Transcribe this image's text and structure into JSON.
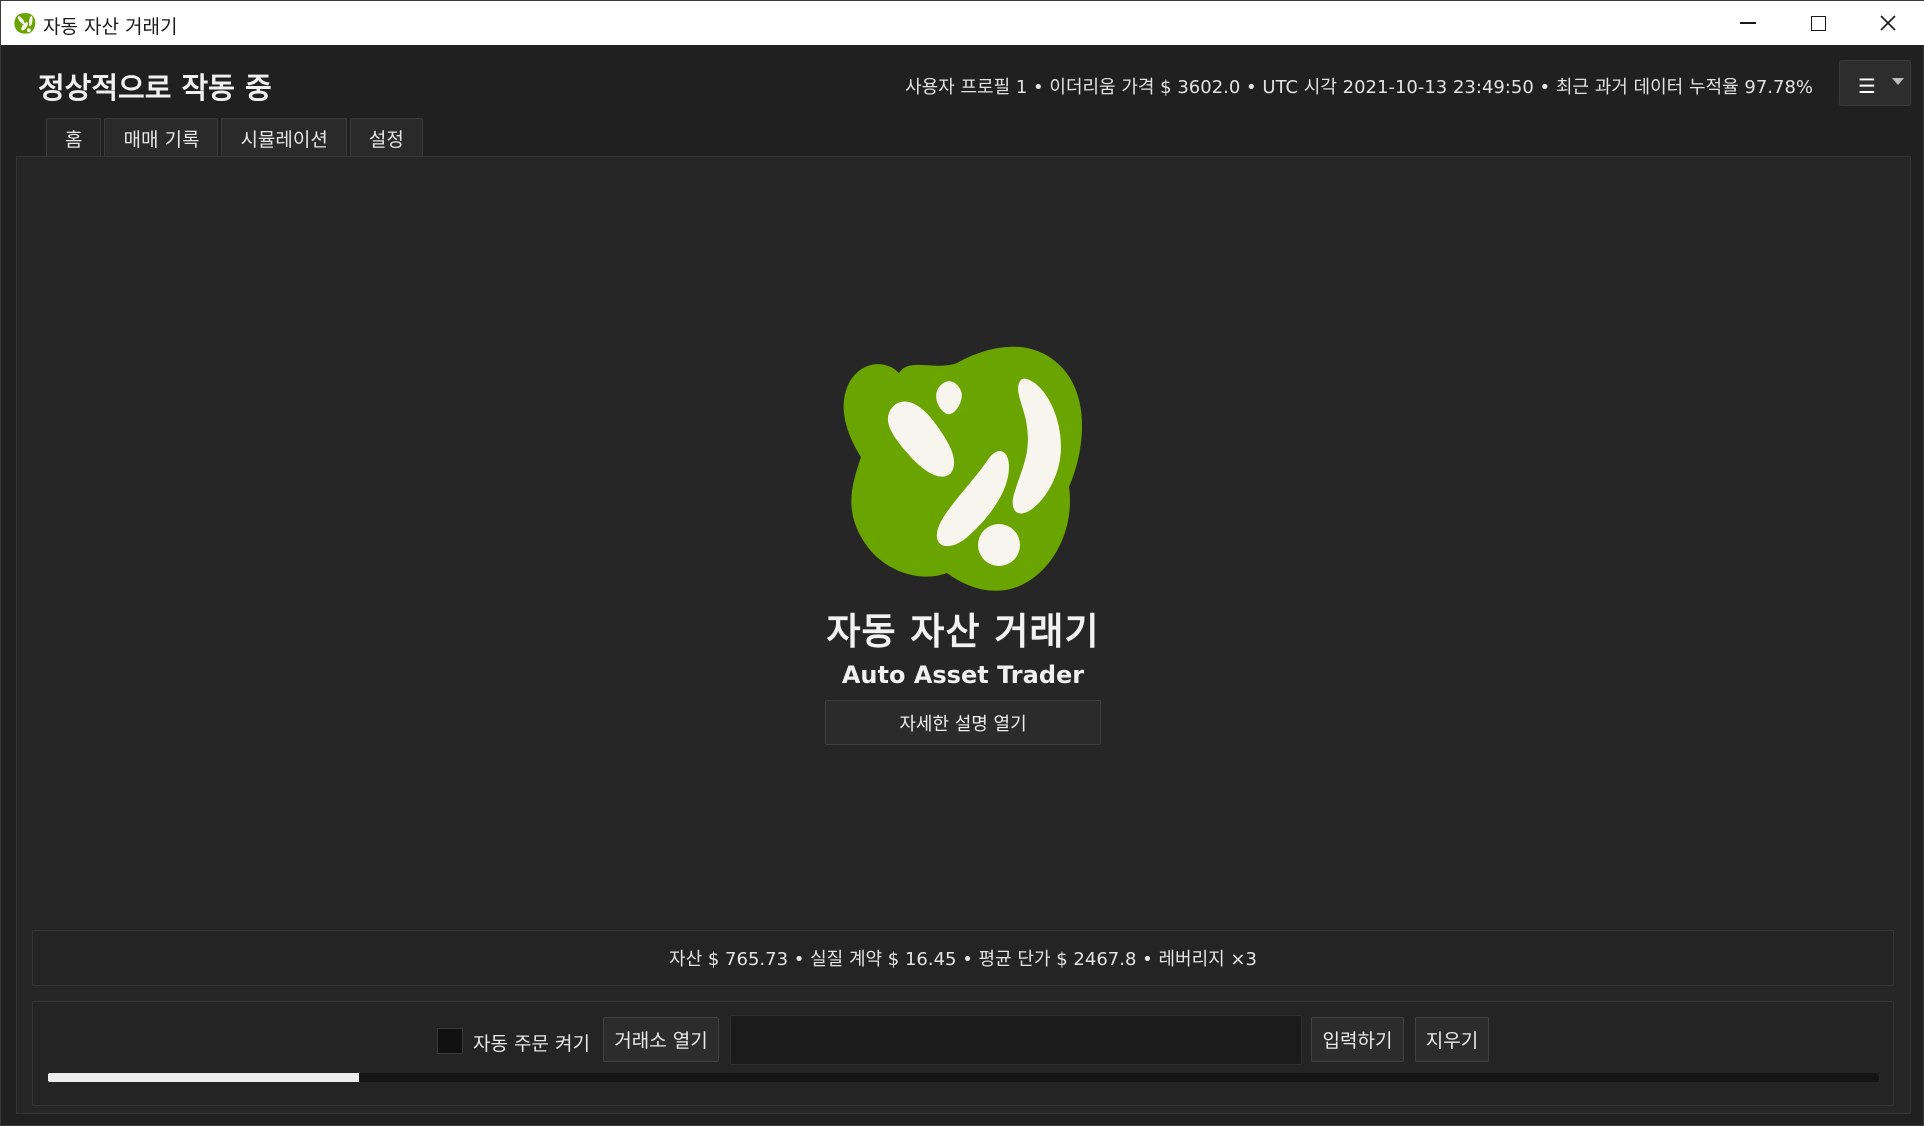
{
  "window": {
    "title": "자동 자산 거래기",
    "brand_color": "#6aa400"
  },
  "header": {
    "status_title": "정상적으로 작동 중",
    "info_line": "사용자 프로필 1  •  이더리움 가격  $ 3602.0  •  UTC 시각 2021-10-13 23:49:50  •  최근 과거 데이터 누적율 97.78%",
    "menu_icon": "hamburger-menu-icon"
  },
  "tabs": [
    {
      "label": "홈",
      "active": true
    },
    {
      "label": "매매 기록",
      "active": false
    },
    {
      "label": "시뮬레이션",
      "active": false
    },
    {
      "label": "설정",
      "active": false
    }
  ],
  "home": {
    "app_name": "자동 자산 거래기",
    "app_subtitle": "Auto Asset Trader",
    "detail_button": "자세한 설명 열기"
  },
  "asset_bar": {
    "text": "자산  $ 765.73  •  실질 계약  $ 16.45  •  평균 단가  $ 2467.8  •  레버리지  ×3"
  },
  "controls": {
    "auto_order_label": "자동 주문 켜기",
    "auto_order_checked": false,
    "exchange_button": "거래소 열기",
    "command_input_value": "",
    "enter_button": "입력하기",
    "clear_button": "지우기",
    "progress": 0.17
  }
}
